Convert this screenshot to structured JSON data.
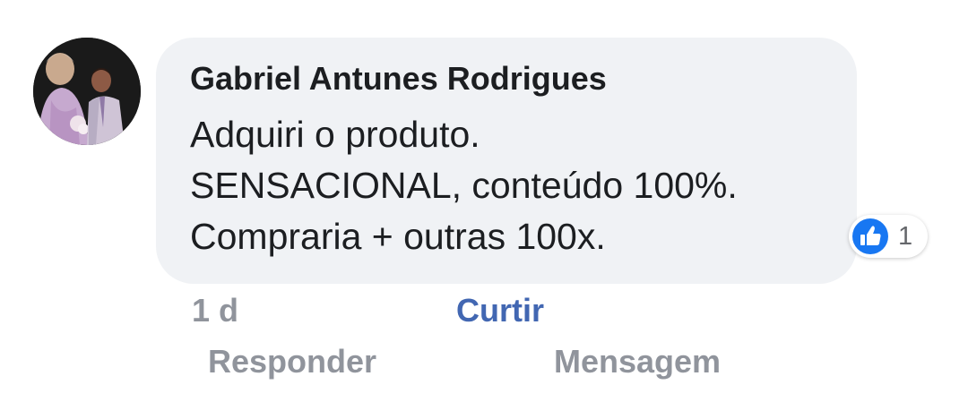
{
  "comment": {
    "author": "Gabriel Antunes Rodrigues",
    "text_lines": [
      "Adquiri o produto.",
      "SENSACIONAL, conteúdo 100%.",
      "Compraria + outras 100x."
    ],
    "reaction": {
      "icon": "like-icon",
      "count": "1",
      "color": "#1877f2"
    },
    "time": "1 d",
    "actions": {
      "like_label": "Curtir",
      "reply_label": "Responder",
      "message_label": "Mensagem"
    }
  },
  "colors": {
    "bubble": "#f0f2f5",
    "link_blue": "#4267b2",
    "muted_text": "#90949c"
  }
}
